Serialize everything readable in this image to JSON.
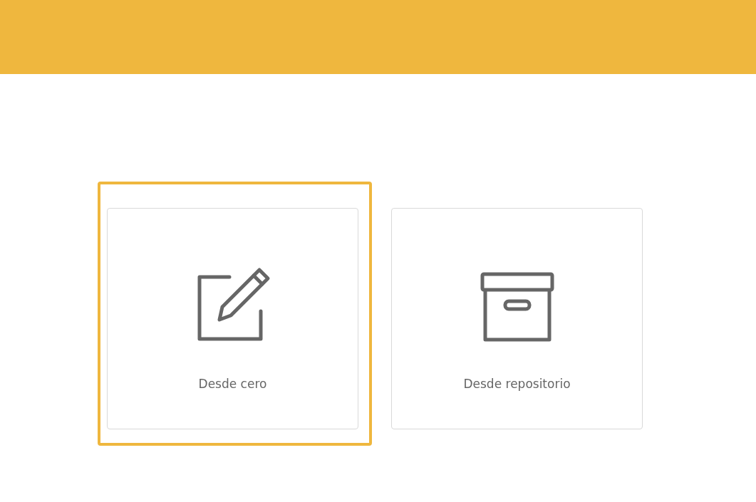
{
  "options": [
    {
      "kind": "pencil",
      "label": "Desde cero",
      "selected": true
    },
    {
      "kind": "box",
      "label": "Desde repositorio",
      "selected": false
    }
  ]
}
